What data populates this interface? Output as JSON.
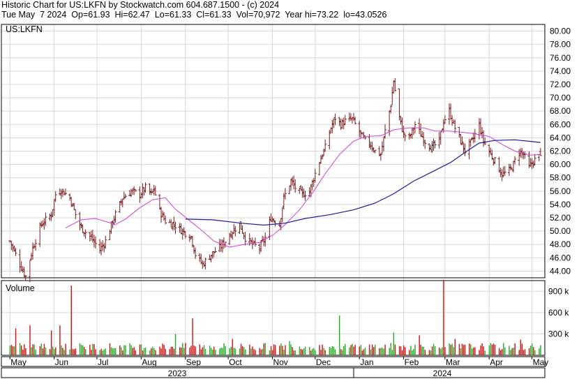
{
  "header": {
    "line1": "Historic Chart for US:LKFN by Stockwatch.com 604.687.1500 - (c) 2024",
    "line2": "Tue May  7 2024  Op=61.93  Hi=62.47  Lo=61.33  Cl=61.33  Vol=70,972  Year hi=73.22  lo=43.0526"
  },
  "colors": {
    "price_bar": "#7a1a1a",
    "ma_short": "#d63cd6",
    "ma_long": "#1a1a9e",
    "volume_up": "#22aa22",
    "volume_down": "#cc1111",
    "grid": "#d8d8d8"
  },
  "chart_data": [
    {
      "type": "bar",
      "subtype": "ohlc_price",
      "symbol_label": "US:LKFN",
      "ylim": [
        43,
        81
      ],
      "y_ticks": [
        "80.00",
        "78.00",
        "76.00",
        "74.00",
        "72.00",
        "70.00",
        "68.00",
        "66.00",
        "64.00",
        "62.00",
        "60.00",
        "58.00",
        "56.00",
        "54.00",
        "52.00",
        "50.00",
        "48.00",
        "46.00",
        "44.00"
      ],
      "x_month_labels": [
        "May",
        "Jun",
        "Jul",
        "Aug",
        "Sep",
        "Oct",
        "Nov",
        "Dec",
        "Jan",
        "Feb",
        "Mar",
        "Apr",
        "May"
      ],
      "x_year_labels": [
        "2023",
        "2024"
      ],
      "close_path": [
        {
          "x": "2023-05-01",
          "y": 48.5
        },
        {
          "x": "2023-05-08",
          "y": 45.0
        },
        {
          "x": "2023-05-12",
          "y": 43.2
        },
        {
          "x": "2023-05-17",
          "y": 47.5
        },
        {
          "x": "2023-05-23",
          "y": 51.0
        },
        {
          "x": "2023-05-30",
          "y": 52.5
        },
        {
          "x": "2023-06-02",
          "y": 55.5
        },
        {
          "x": "2023-06-06",
          "y": 56.2
        },
        {
          "x": "2023-06-12",
          "y": 55.0
        },
        {
          "x": "2023-06-16",
          "y": 52.5
        },
        {
          "x": "2023-06-20",
          "y": 50.5
        },
        {
          "x": "2023-06-27",
          "y": 49.0
        },
        {
          "x": "2023-07-03",
          "y": 47.2
        },
        {
          "x": "2023-07-07",
          "y": 48.5
        },
        {
          "x": "2023-07-13",
          "y": 52.0
        },
        {
          "x": "2023-07-19",
          "y": 55.0
        },
        {
          "x": "2023-07-25",
          "y": 56.0
        },
        {
          "x": "2023-07-31",
          "y": 55.5
        },
        {
          "x": "2023-08-04",
          "y": 56.5
        },
        {
          "x": "2023-08-08",
          "y": 55.5
        },
        {
          "x": "2023-08-10",
          "y": 56.3
        },
        {
          "x": "2023-08-14",
          "y": 53.0
        },
        {
          "x": "2023-08-18",
          "y": 51.5
        },
        {
          "x": "2023-08-24",
          "y": 51.0
        },
        {
          "x": "2023-08-30",
          "y": 50.0
        },
        {
          "x": "2023-09-05",
          "y": 49.2
        },
        {
          "x": "2023-09-08",
          "y": 46.5
        },
        {
          "x": "2023-09-13",
          "y": 45.0
        },
        {
          "x": "2023-09-19",
          "y": 46.5
        },
        {
          "x": "2023-09-25",
          "y": 47.5
        },
        {
          "x": "2023-09-29",
          "y": 48.5
        },
        {
          "x": "2023-10-04",
          "y": 50.0
        },
        {
          "x": "2023-10-09",
          "y": 51.0
        },
        {
          "x": "2023-10-13",
          "y": 49.0
        },
        {
          "x": "2023-10-18",
          "y": 48.0
        },
        {
          "x": "2023-10-23",
          "y": 47.5
        },
        {
          "x": "2023-10-27",
          "y": 49.0
        },
        {
          "x": "2023-10-31",
          "y": 52.0
        },
        {
          "x": "2023-11-06",
          "y": 51.0
        },
        {
          "x": "2023-11-09",
          "y": 55.0
        },
        {
          "x": "2023-11-14",
          "y": 57.5
        },
        {
          "x": "2023-11-17",
          "y": 56.5
        },
        {
          "x": "2023-11-22",
          "y": 55.5
        },
        {
          "x": "2023-11-27",
          "y": 56.0
        },
        {
          "x": "2023-11-30",
          "y": 58.0
        },
        {
          "x": "2023-12-04",
          "y": 60.5
        },
        {
          "x": "2023-12-08",
          "y": 62.5
        },
        {
          "x": "2023-12-12",
          "y": 65.5
        },
        {
          "x": "2023-12-15",
          "y": 67.0
        },
        {
          "x": "2023-12-19",
          "y": 66.0
        },
        {
          "x": "2023-12-22",
          "y": 66.5
        },
        {
          "x": "2023-12-27",
          "y": 66.8
        },
        {
          "x": "2024-01-02",
          "y": 64.5
        },
        {
          "x": "2024-01-05",
          "y": 63.5
        },
        {
          "x": "2024-01-09",
          "y": 63.0
        },
        {
          "x": "2024-01-12",
          "y": 62.0
        },
        {
          "x": "2024-01-16",
          "y": 61.5
        },
        {
          "x": "2024-01-19",
          "y": 65.0
        },
        {
          "x": "2024-01-23",
          "y": 69.0
        },
        {
          "x": "2024-01-25",
          "y": 72.5
        },
        {
          "x": "2024-01-29",
          "y": 67.0
        },
        {
          "x": "2024-02-01",
          "y": 64.5
        },
        {
          "x": "2024-02-05",
          "y": 64.0
        },
        {
          "x": "2024-02-09",
          "y": 66.0
        },
        {
          "x": "2024-02-13",
          "y": 64.5
        },
        {
          "x": "2024-02-16",
          "y": 63.5
        },
        {
          "x": "2024-02-21",
          "y": 62.5
        },
        {
          "x": "2024-02-26",
          "y": 63.5
        },
        {
          "x": "2024-02-29",
          "y": 66.5
        },
        {
          "x": "2024-03-04",
          "y": 68.0
        },
        {
          "x": "2024-03-07",
          "y": 66.0
        },
        {
          "x": "2024-03-12",
          "y": 63.5
        },
        {
          "x": "2024-03-15",
          "y": 62.0
        },
        {
          "x": "2024-03-20",
          "y": 63.5
        },
        {
          "x": "2024-03-25",
          "y": 66.0
        },
        {
          "x": "2024-03-28",
          "y": 63.5
        },
        {
          "x": "2024-04-02",
          "y": 61.5
        },
        {
          "x": "2024-04-05",
          "y": 60.5
        },
        {
          "x": "2024-04-10",
          "y": 58.5
        },
        {
          "x": "2024-04-15",
          "y": 59.0
        },
        {
          "x": "2024-04-18",
          "y": 60.0
        },
        {
          "x": "2024-04-22",
          "y": 62.0
        },
        {
          "x": "2024-04-25",
          "y": 61.5
        },
        {
          "x": "2024-04-29",
          "y": 59.5
        },
        {
          "x": "2024-05-02",
          "y": 60.5
        },
        {
          "x": "2024-05-07",
          "y": 61.33
        }
      ],
      "ma_short": [
        {
          "x": "2023-06-09",
          "y": 50.5
        },
        {
          "x": "2023-06-20",
          "y": 51.7
        },
        {
          "x": "2023-06-30",
          "y": 51.9
        },
        {
          "x": "2023-07-14",
          "y": 51.0
        },
        {
          "x": "2023-07-21",
          "y": 51.8
        },
        {
          "x": "2023-07-31",
          "y": 53.5
        },
        {
          "x": "2023-08-09",
          "y": 54.7
        },
        {
          "x": "2023-08-18",
          "y": 55.0
        },
        {
          "x": "2023-08-25",
          "y": 53.3
        },
        {
          "x": "2023-09-05",
          "y": 51.4
        },
        {
          "x": "2023-09-12",
          "y": 50.2
        },
        {
          "x": "2023-09-21",
          "y": 48.5
        },
        {
          "x": "2023-10-02",
          "y": 47.6
        },
        {
          "x": "2023-10-12",
          "y": 48.0
        },
        {
          "x": "2023-10-23",
          "y": 48.3
        },
        {
          "x": "2023-11-02",
          "y": 49.5
        },
        {
          "x": "2023-11-10",
          "y": 51.0
        },
        {
          "x": "2023-11-20",
          "y": 53.2
        },
        {
          "x": "2023-11-30",
          "y": 56.0
        },
        {
          "x": "2023-12-08",
          "y": 58.6
        },
        {
          "x": "2023-12-18",
          "y": 61.5
        },
        {
          "x": "2023-12-28",
          "y": 63.5
        },
        {
          "x": "2024-01-05",
          "y": 64.2
        },
        {
          "x": "2024-01-16",
          "y": 64.3
        },
        {
          "x": "2024-01-25",
          "y": 65.2
        },
        {
          "x": "2024-02-05",
          "y": 65.5
        },
        {
          "x": "2024-02-15",
          "y": 65.5
        },
        {
          "x": "2024-02-23",
          "y": 65.0
        },
        {
          "x": "2024-03-04",
          "y": 65.0
        },
        {
          "x": "2024-03-14",
          "y": 64.8
        },
        {
          "x": "2024-03-22",
          "y": 64.6
        },
        {
          "x": "2024-04-01",
          "y": 64.2
        },
        {
          "x": "2024-04-10",
          "y": 63.0
        },
        {
          "x": "2024-04-19",
          "y": 62.0
        },
        {
          "x": "2024-04-30",
          "y": 61.4
        },
        {
          "x": "2024-05-07",
          "y": 61.5
        }
      ],
      "ma_long": [
        {
          "x": "2023-09-01",
          "y": 51.8
        },
        {
          "x": "2023-09-20",
          "y": 51.7
        },
        {
          "x": "2023-10-10",
          "y": 51.2
        },
        {
          "x": "2023-10-26",
          "y": 50.9
        },
        {
          "x": "2023-11-10",
          "y": 51.2
        },
        {
          "x": "2023-11-24",
          "y": 51.9
        },
        {
          "x": "2023-12-12",
          "y": 52.5
        },
        {
          "x": "2023-12-28",
          "y": 53.2
        },
        {
          "x": "2024-01-12",
          "y": 54.2
        },
        {
          "x": "2024-01-25",
          "y": 55.6
        },
        {
          "x": "2024-02-08",
          "y": 57.5
        },
        {
          "x": "2024-02-22",
          "y": 59.0
        },
        {
          "x": "2024-03-05",
          "y": 60.3
        },
        {
          "x": "2024-03-15",
          "y": 61.8
        },
        {
          "x": "2024-03-25",
          "y": 63.2
        },
        {
          "x": "2024-04-05",
          "y": 63.6
        },
        {
          "x": "2024-04-19",
          "y": 63.7
        },
        {
          "x": "2024-05-07",
          "y": 63.3
        }
      ],
      "last_bar": {
        "x": "2024-05-07",
        "open": 61.93,
        "high": 62.47,
        "low": 61.33,
        "close": 61.33
      }
    },
    {
      "type": "bar",
      "subtype": "volume",
      "title": "Volume",
      "ylim": [
        0,
        1050000
      ],
      "y_ticks": [
        "900 k",
        "600 k",
        "300 k"
      ],
      "baseline": 120000,
      "spikes": [
        {
          "x": "2023-05-05",
          "y": 380000
        },
        {
          "x": "2023-05-15",
          "y": 420000
        },
        {
          "x": "2023-05-30",
          "y": 350000
        },
        {
          "x": "2023-06-05",
          "y": 420000
        },
        {
          "x": "2023-06-13",
          "y": 980000
        },
        {
          "x": "2023-08-25",
          "y": 300000
        },
        {
          "x": "2023-09-06",
          "y": 520000
        },
        {
          "x": "2023-10-04",
          "y": 230000
        },
        {
          "x": "2023-11-13",
          "y": 200000
        },
        {
          "x": "2023-12-18",
          "y": 560000
        },
        {
          "x": "2024-01-25",
          "y": 320000
        },
        {
          "x": "2024-02-12",
          "y": 280000
        },
        {
          "x": "2024-02-29",
          "y": 1060000
        },
        {
          "x": "2024-03-08",
          "y": 230000
        },
        {
          "x": "2024-04-23",
          "y": 220000
        }
      ]
    }
  ]
}
